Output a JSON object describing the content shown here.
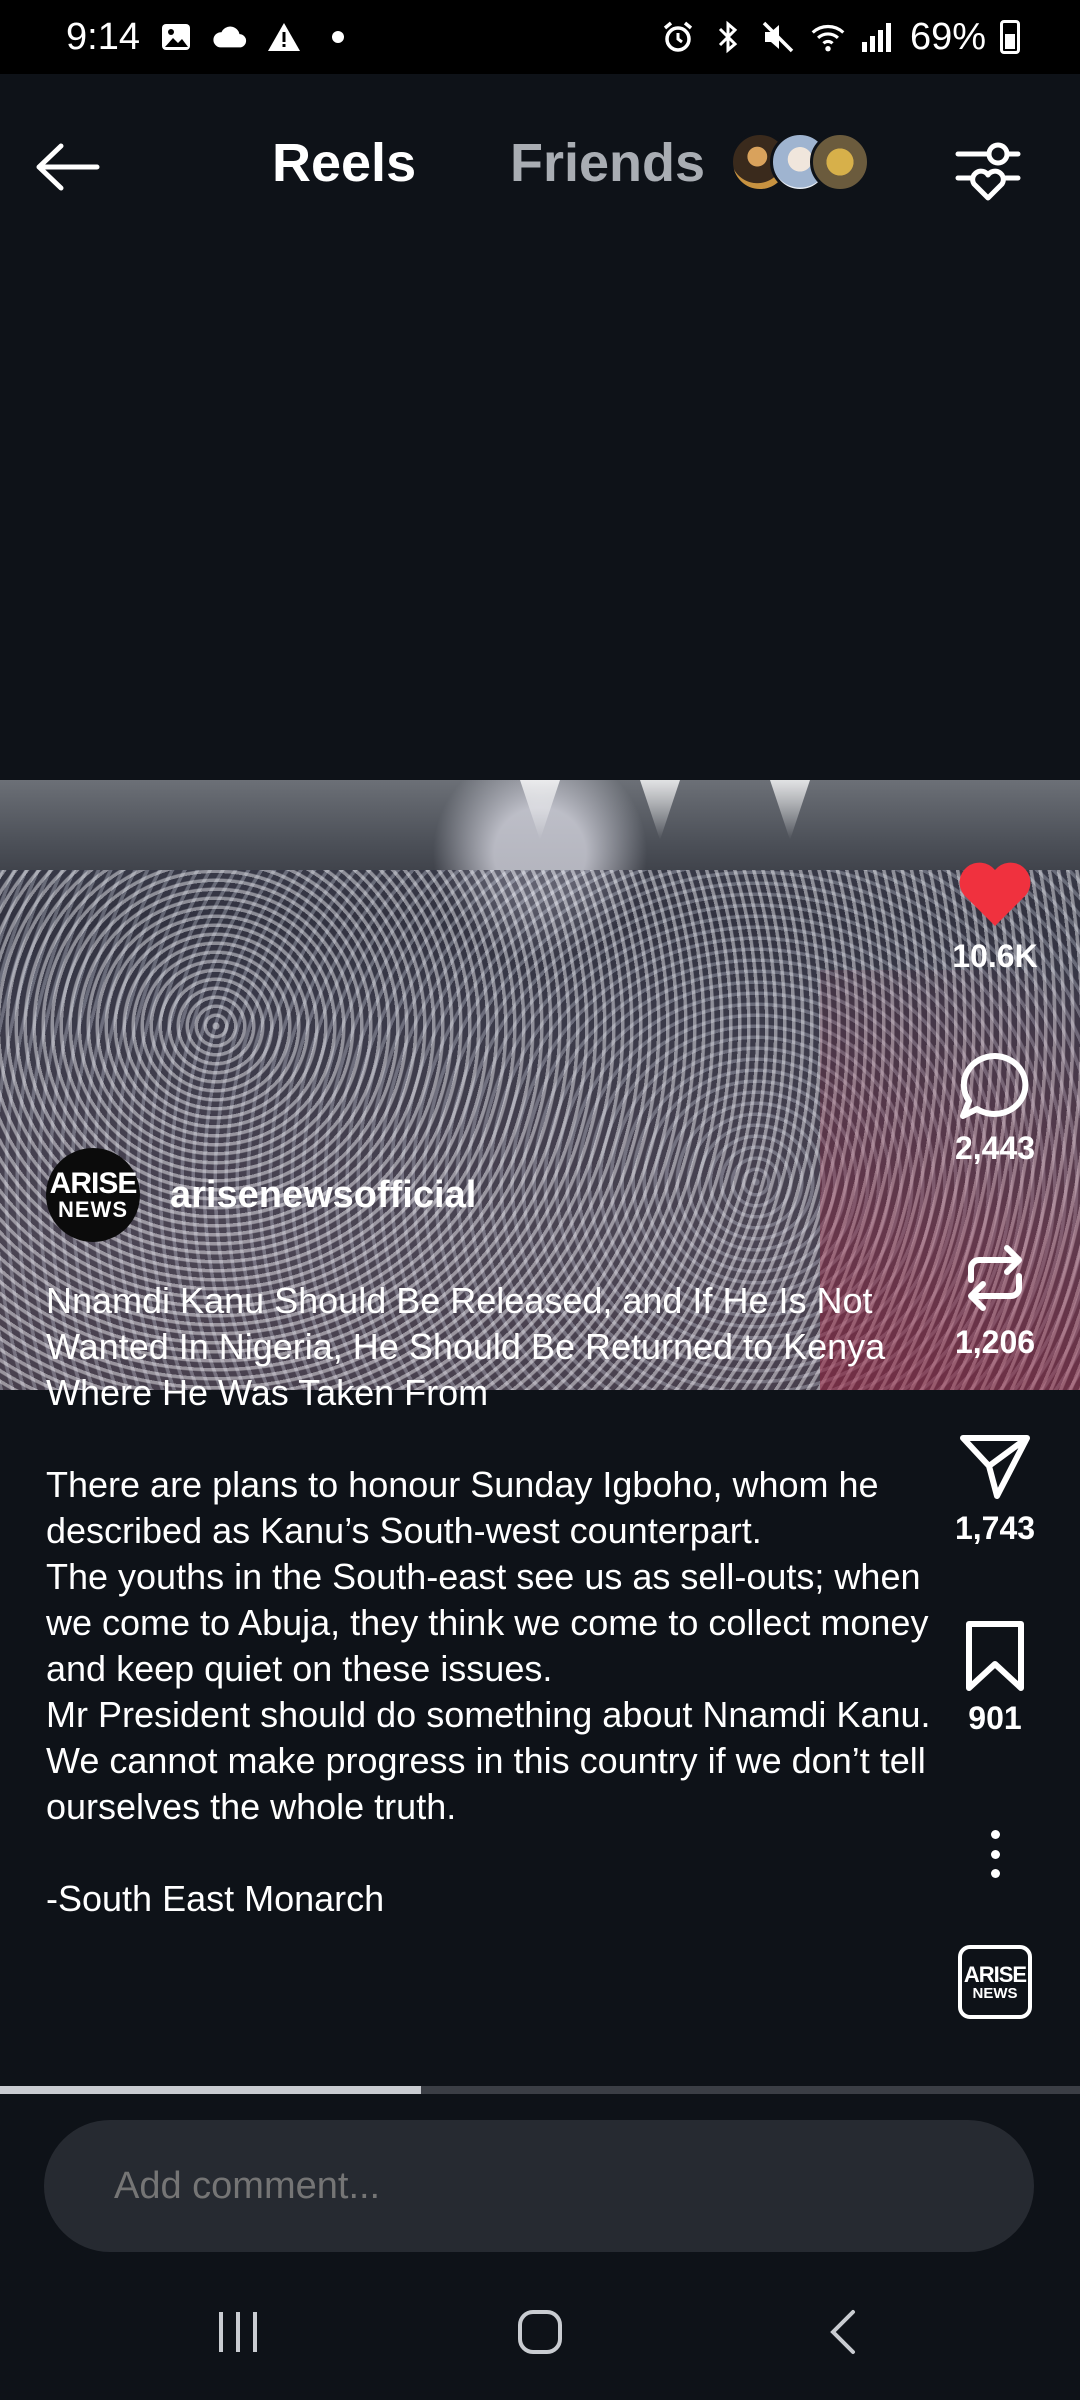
{
  "status_bar": {
    "time": "9:14",
    "battery_percent": "69%",
    "left_icons": [
      "gallery-icon",
      "cloud-icon",
      "warning-icon",
      "dot-icon"
    ],
    "right_icons": [
      "alarm-icon",
      "bluetooth-icon",
      "mute-icon",
      "wifi-icon",
      "signal-icon",
      "battery-icon"
    ]
  },
  "top_nav": {
    "tabs": [
      {
        "label": "Reels",
        "active": true
      },
      {
        "label": "Friends",
        "active": false
      }
    ]
  },
  "post": {
    "author": "arisenewsofficial",
    "author_logo": {
      "line1": "ARISE",
      "line2": "NEWS"
    },
    "caption_title": "Nnamdi Kanu Should Be Released, and If He Is Not Wanted In Nigeria, He Should Be Returned to Kenya Where He Was Taken From",
    "caption_body": [
      "There are plans to honour Sunday Igboho, whom he described as Kanu’s South-west counterpart.",
      "The youths in the South-east see us as sell-outs; when we come to Abuja, they think we come to collect money and keep quiet on these issues.",
      "Mr President should do something about Nnamdi Kanu.",
      "We cannot make progress in this country if we don’t tell ourselves the whole truth."
    ],
    "caption_signature": "-South East Monarch"
  },
  "actions": {
    "likes": "10.6K",
    "comments": "2,443",
    "reposts": "1,206",
    "shares": "1,743",
    "saves": "901",
    "like_color": "#f0313e"
  },
  "audio_badge": {
    "line1": "ARISE",
    "line2": "NEWS"
  },
  "progress": {
    "fraction": 0.39
  },
  "comment_input": {
    "placeholder": "Add comment..."
  }
}
